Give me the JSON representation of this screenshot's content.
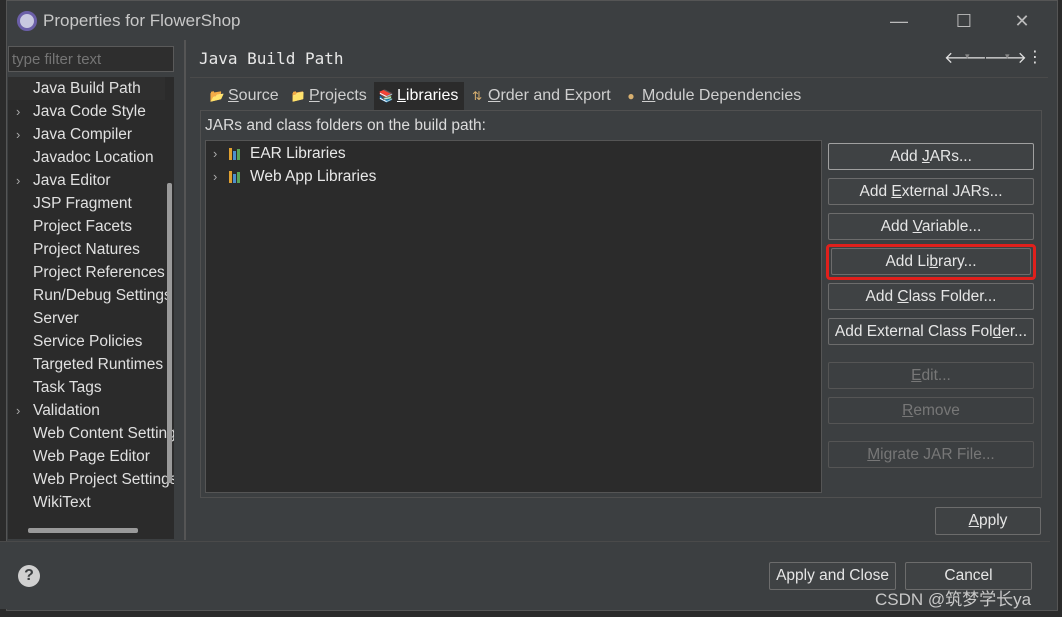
{
  "window": {
    "title": "Properties for FlowerShop",
    "minimize": "—",
    "maximize": "☐",
    "close": "✕"
  },
  "filter": {
    "placeholder": "type filter text"
  },
  "nav_tree": [
    {
      "label": "Java Build Path",
      "expandable": false,
      "selected": true
    },
    {
      "label": "Java Code Style",
      "expandable": true
    },
    {
      "label": "Java Compiler",
      "expandable": true
    },
    {
      "label": "Javadoc Location",
      "expandable": false
    },
    {
      "label": "Java Editor",
      "expandable": true
    },
    {
      "label": "JSP Fragment",
      "expandable": false
    },
    {
      "label": "Project Facets",
      "expandable": false
    },
    {
      "label": "Project Natures",
      "expandable": false
    },
    {
      "label": "Project References",
      "expandable": false
    },
    {
      "label": "Run/Debug Settings",
      "expandable": false
    },
    {
      "label": "Server",
      "expandable": false
    },
    {
      "label": "Service Policies",
      "expandable": false
    },
    {
      "label": "Targeted Runtimes",
      "expandable": false
    },
    {
      "label": "Task Tags",
      "expandable": false
    },
    {
      "label": "Validation",
      "expandable": true
    },
    {
      "label": "Web Content Settings",
      "expandable": false
    },
    {
      "label": "Web Page Editor",
      "expandable": false
    },
    {
      "label": "Web Project Settings",
      "expandable": false
    },
    {
      "label": "WikiText",
      "expandable": false
    }
  ],
  "page": {
    "title": "Java Build Path",
    "back_icon": "🡐",
    "forward_icon": "🡒",
    "menu_icon": "⋮",
    "dropdown_icon": "▾"
  },
  "tabs": [
    {
      "mn": "S",
      "rest": "ource",
      "icon": "📂"
    },
    {
      "mn": "P",
      "rest": "rojects",
      "icon": "📁"
    },
    {
      "mn": "L",
      "rest": "ibraries",
      "icon": "📚",
      "active": true
    },
    {
      "mn": "O",
      "rest": "rder and Export",
      "icon": "⇅"
    },
    {
      "mn": "M",
      "rest": "odule Dependencies",
      "icon": "●"
    }
  ],
  "libraries": {
    "intro": "JARs and class folders on the build path:",
    "items": [
      "EAR Libraries",
      "Web App Libraries"
    ],
    "expand_icon": "›"
  },
  "buttons": {
    "add_jars": {
      "pre": "Add ",
      "mn": "J",
      "post": "ARs..."
    },
    "add_external_jars": {
      "pre": "Add ",
      "mn": "E",
      "post": "xternal JARs..."
    },
    "add_variable": {
      "pre": "Add ",
      "mn": "V",
      "post": "ariable..."
    },
    "add_library": {
      "pre": "Add Li",
      "mn": "b",
      "post": "rary..."
    },
    "add_class_folder": {
      "pre": "Add ",
      "mn": "C",
      "post": "lass Folder..."
    },
    "add_external_class_folder": {
      "pre": "Add External Class Fol",
      "mn": "d",
      "post": "er..."
    },
    "edit": {
      "pre": "",
      "mn": "E",
      "post": "dit..."
    },
    "remove": {
      "pre": "",
      "mn": "R",
      "post": "emove"
    },
    "migrate": {
      "pre": "",
      "mn": "M",
      "post": "igrate JAR File..."
    },
    "apply": {
      "pre": "",
      "mn": "A",
      "post": "pply"
    },
    "apply_and_close": "Apply and Close",
    "cancel": "Cancel"
  },
  "help": {
    "icon": "?"
  },
  "watermark": "CSDN @筑梦学长ya",
  "colors": {
    "highlight": "#e0201c",
    "background": "#3c3f41",
    "tree_bg": "#2b2b2b"
  }
}
